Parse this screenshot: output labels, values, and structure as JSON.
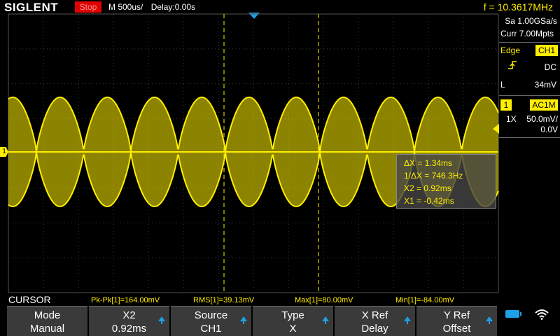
{
  "header": {
    "brand": "SIGLENT",
    "run_state": "Stop",
    "timebase": "M 500us/",
    "delay": "Delay:0.00s",
    "frequency": "f = 10.3617MHz"
  },
  "acquisition": {
    "sample_rate": "Sa 1.00GSa/s",
    "memory": "Curr 7.00Mpts"
  },
  "trigger": {
    "type": "Edge",
    "source": "CH1",
    "slope_icon": "rising-edge-icon",
    "coupling": "DC",
    "mode_letter": "L",
    "level": "34mV"
  },
  "channel": {
    "number": "1",
    "coupling": "AC1M",
    "probe": "1X",
    "scale": "50.0mV/",
    "offset": "0.0V",
    "marker": "1"
  },
  "cursor_readout": {
    "delta_x": "ΔX = 1.34ms",
    "inv_delta_x": "1/ΔX = 746.3Hz",
    "x2": "X2 = 0.92ms",
    "x1": "X1 = -0.42ms"
  },
  "measurements": {
    "title": "CURSOR",
    "pkpk": "Pk-Pk[1]=164.00mV",
    "rms": "RMS[1]=39.13mV",
    "max": "Max[1]=80.00mV",
    "min": "Min[1]=-84.00mV"
  },
  "softkeys": [
    {
      "label": "Mode",
      "value": "Manual",
      "has_arrow": false
    },
    {
      "label": "X2",
      "value": "0.92ms",
      "has_arrow": true
    },
    {
      "label": "Source",
      "value": "CH1",
      "has_arrow": true
    },
    {
      "label": "Type",
      "value": "X",
      "has_arrow": true
    },
    {
      "label": "X Ref",
      "value": "Delay",
      "has_arrow": true
    },
    {
      "label": "Y Ref",
      "value": "Offset",
      "has_arrow": true
    }
  ],
  "colors": {
    "trace": "#ffee00",
    "accent": "#1ea0e6",
    "run_stop": "#e00000"
  }
}
